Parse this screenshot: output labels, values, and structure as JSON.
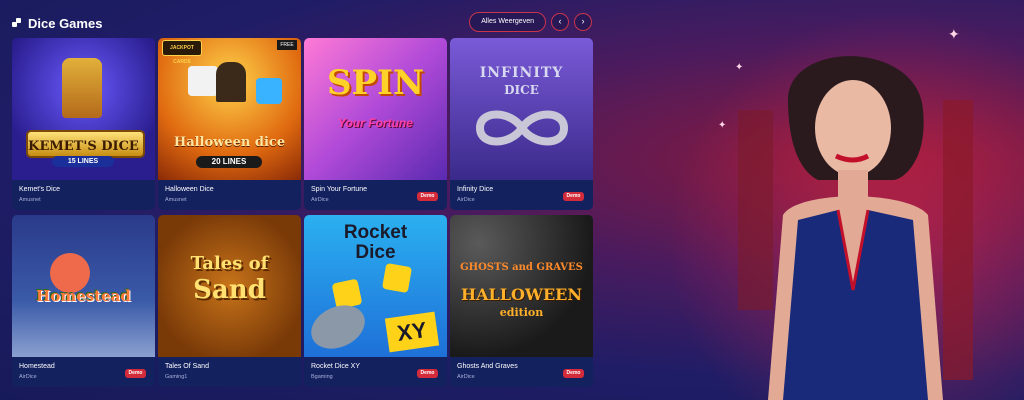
{
  "section": {
    "title": "Dice Games",
    "show_all": "Alles Weergeven",
    "prev": "‹",
    "next": "›"
  },
  "games": [
    {
      "name": "Kemet's Dice",
      "provider": "Amusnet",
      "demo": "",
      "art_title": "KEMET'S DICE",
      "art_sub": "15 LINES"
    },
    {
      "name": "Halloween Dice",
      "provider": "Amusnet",
      "demo": "",
      "art_title": "Halloween dice",
      "art_sub": "20 LINES",
      "badge_top": "JACKPOT CARDS",
      "badge_free": "FREE"
    },
    {
      "name": "Spin Your Fortune",
      "provider": "AirDice",
      "demo": "Demo",
      "art_title": "SPIN",
      "art_sub": "Your Fortune"
    },
    {
      "name": "Infinity Dice",
      "provider": "AirDice",
      "demo": "Demo",
      "art_title": "INFINITY",
      "art_sub": "DICE"
    },
    {
      "name": "Homestead",
      "provider": "AirDice",
      "demo": "Demo",
      "art_title": "Homestead",
      "art_sub": ""
    },
    {
      "name": "Tales Of Sand",
      "provider": "Gaming1",
      "demo": "",
      "art_title": "Tales of",
      "art_sub": "Sand"
    },
    {
      "name": "Rocket Dice XY",
      "provider": "Bgaming",
      "demo": "Demo",
      "art_title": "Rocket Dice",
      "art_sub": "XY"
    },
    {
      "name": "Ghosts And Graves",
      "provider": "AirDice",
      "demo": "Demo",
      "art_title": "GHOSTS and GRAVES",
      "art_sub": "HALLOWEEN",
      "art_sub2": "edition"
    }
  ],
  "colors": {
    "accent": "#d42b3a",
    "card_bg": "#14215f"
  }
}
